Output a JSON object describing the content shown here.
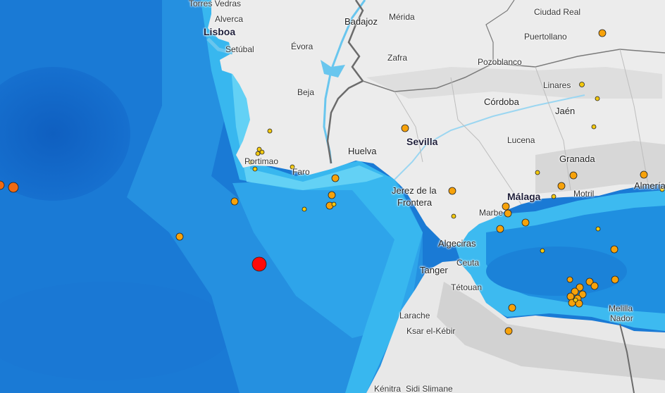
{
  "colors": {
    "deep_ocean": "#1670cf",
    "mid_ocean": "#1f8de0",
    "shelf": "#34b6ef",
    "shallow": "#5fd0f5",
    "land": "#ececec",
    "border": "#6b6b6b",
    "river": "#69c6ee",
    "quake_small": "#f2c80f",
    "quake_medium": "#f7a20a",
    "quake_large": "#f06a12",
    "quake_latest": "#ff0a0a"
  },
  "places": [
    {
      "id": "torres-vedras",
      "name": "Torres Vedras",
      "size": "sm"
    },
    {
      "id": "alverca",
      "name": "Alverca",
      "size": "sm"
    },
    {
      "id": "lisboa",
      "name": "Lisboa",
      "size": "bg"
    },
    {
      "id": "setubal",
      "name": "Setúbal",
      "size": "sm"
    },
    {
      "id": "evora",
      "name": "Évora",
      "size": "sm"
    },
    {
      "id": "badajoz",
      "name": "Badajoz",
      "size": "md"
    },
    {
      "id": "merida",
      "name": "Mérida",
      "size": "sm"
    },
    {
      "id": "zafra",
      "name": "Zafra",
      "size": "sm"
    },
    {
      "id": "ciudad-real",
      "name": "Ciudad Real",
      "size": "sm"
    },
    {
      "id": "puertollano",
      "name": "Puertollano",
      "size": "sm"
    },
    {
      "id": "pozoblanco",
      "name": "Pozoblanco",
      "size": "sm"
    },
    {
      "id": "linares",
      "name": "Linares",
      "size": "sm"
    },
    {
      "id": "beja",
      "name": "Beja",
      "size": "sm"
    },
    {
      "id": "cordoba",
      "name": "Córdoba",
      "size": "md"
    },
    {
      "id": "jaen",
      "name": "Jaén",
      "size": "md"
    },
    {
      "id": "sevilla",
      "name": "Sevilla",
      "size": "bg"
    },
    {
      "id": "huelva",
      "name": "Huelva",
      "size": "md"
    },
    {
      "id": "lucena",
      "name": "Lucena",
      "size": "sm"
    },
    {
      "id": "portimao",
      "name": "Portimao",
      "size": "sm"
    },
    {
      "id": "faro",
      "name": "Faro",
      "size": "sm"
    },
    {
      "id": "granada",
      "name": "Granada",
      "size": "md"
    },
    {
      "id": "jerez-1",
      "name": "Jerez de la",
      "size": "md"
    },
    {
      "id": "jerez-2",
      "name": "Frontera",
      "size": "md"
    },
    {
      "id": "malaga",
      "name": "Málaga",
      "size": "bg"
    },
    {
      "id": "motril",
      "name": "Motril",
      "size": "sm"
    },
    {
      "id": "almeria",
      "name": "Almería",
      "size": "md"
    },
    {
      "id": "marbella",
      "name": "Marbe",
      "size": "sm"
    },
    {
      "id": "algeciras",
      "name": "Algeciras",
      "size": "md"
    },
    {
      "id": "ceuta",
      "name": "Ceuta",
      "size": "sm"
    },
    {
      "id": "tanger",
      "name": "Tanger",
      "size": "md"
    },
    {
      "id": "tetouan",
      "name": "Tétouan",
      "size": "sm"
    },
    {
      "id": "larache",
      "name": "Larache",
      "size": "sm"
    },
    {
      "id": "ksar",
      "name": "Ksar el-Kébir",
      "size": "sm"
    },
    {
      "id": "melilla",
      "name": "Melilla",
      "size": "sm"
    },
    {
      "id": "nador",
      "name": "Nador",
      "size": "sm"
    },
    {
      "id": "kenitra",
      "name": "Kénitra",
      "size": "sm"
    },
    {
      "id": "sidi-slimane",
      "name": "Sidi Slimane",
      "size": "sm"
    }
  ]
}
